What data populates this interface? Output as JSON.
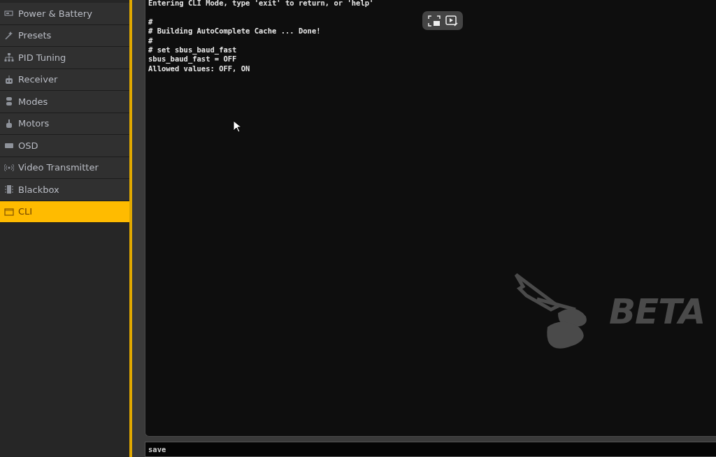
{
  "sidebar": {
    "items": [
      {
        "label": "Power & Battery",
        "selected": false
      },
      {
        "label": "Presets",
        "selected": false
      },
      {
        "label": "PID Tuning",
        "selected": false
      },
      {
        "label": "Receiver",
        "selected": false
      },
      {
        "label": "Modes",
        "selected": false
      },
      {
        "label": "Motors",
        "selected": false
      },
      {
        "label": "OSD",
        "selected": false
      },
      {
        "label": "Video Transmitter",
        "selected": false
      },
      {
        "label": "Blackbox",
        "selected": false
      },
      {
        "label": "CLI",
        "selected": true
      }
    ]
  },
  "console": {
    "blocks": [
      [
        "Entering CLI Mode, type 'exit' to return, or 'help'"
      ],
      [
        "#",
        "# Building AutoComplete Cache ... Done!",
        "#",
        "# set sbus_baud_fast",
        "sbus_baud_fast = OFF",
        "Allowed values: OFF, ON"
      ]
    ],
    "logo_text": "BETA"
  },
  "command_input": {
    "value": "save"
  }
}
